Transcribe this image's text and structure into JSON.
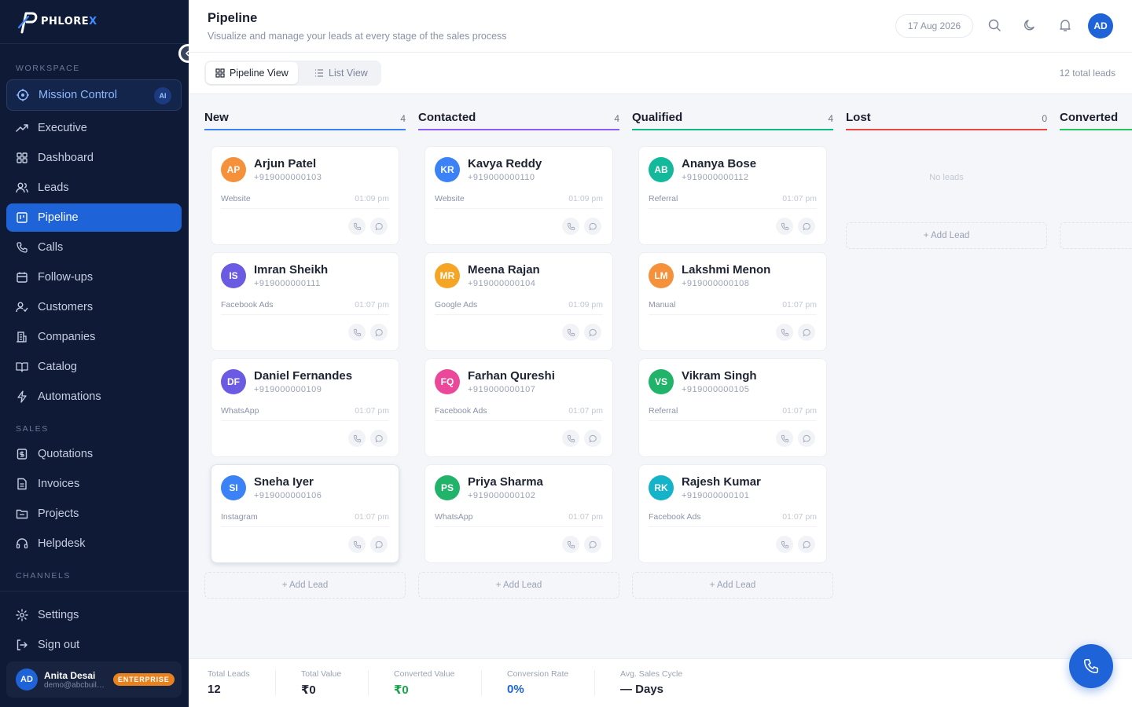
{
  "brand": {
    "name_main": "PHLORE",
    "name_accent": "X"
  },
  "sidebar": {
    "sections": {
      "workspace": "WORKSPACE",
      "sales": "SALES",
      "channels": "CHANNELS"
    },
    "mission_control": {
      "label": "Mission Control",
      "badge": "AI"
    },
    "workspace_items": [
      {
        "label": "Executive",
        "icon": "trending-up-icon"
      },
      {
        "label": "Dashboard",
        "icon": "grid-icon"
      },
      {
        "label": "Leads",
        "icon": "users-icon"
      },
      {
        "label": "Pipeline",
        "icon": "kanban-icon",
        "active": true
      },
      {
        "label": "Calls",
        "icon": "phone-icon"
      },
      {
        "label": "Follow-ups",
        "icon": "calendar-icon"
      },
      {
        "label": "Customers",
        "icon": "user-check-icon"
      },
      {
        "label": "Companies",
        "icon": "building-icon"
      },
      {
        "label": "Catalog",
        "icon": "book-icon"
      },
      {
        "label": "Automations",
        "icon": "bolt-icon"
      }
    ],
    "sales_items": [
      {
        "label": "Quotations",
        "icon": "receipt-icon"
      },
      {
        "label": "Invoices",
        "icon": "file-icon"
      },
      {
        "label": "Projects",
        "icon": "folder-icon"
      },
      {
        "label": "Helpdesk",
        "icon": "headset-icon"
      }
    ],
    "bottom_items": [
      {
        "label": "Settings",
        "icon": "gear-icon"
      },
      {
        "label": "Sign out",
        "icon": "logout-icon"
      }
    ],
    "user": {
      "initials": "AD",
      "name": "Anita Desai",
      "email": "demo@abcbuilders.com",
      "plan": "ENTERPRISE"
    }
  },
  "header": {
    "title": "Pipeline",
    "subtitle": "Visualize and manage your leads at every stage of the sales process",
    "date": "17 Aug 2026",
    "avatar": "AD"
  },
  "toolbar": {
    "pipeline_view": "Pipeline View",
    "list_view": "List View",
    "total_leads": "12 total leads"
  },
  "colors": {
    "accent": "#1e63d8",
    "new": "#3b82f6",
    "contacted": "#8b5cf6",
    "qualified": "#10b981",
    "lost": "#ef4444",
    "converted": "#22c55e"
  },
  "columns": [
    {
      "title": "New",
      "count": "4",
      "color": "#3b82f6",
      "add_label": "+ Add Lead",
      "leads": [
        {
          "initials": "AP",
          "name": "Arjun Patel",
          "phone": "+919000000103",
          "source": "Website",
          "time": "01:09 pm",
          "color": "#f4913a"
        },
        {
          "initials": "IS",
          "name": "Imran Sheikh",
          "phone": "+919000000111",
          "source": "Facebook Ads",
          "time": "01:07 pm",
          "color": "#6a5be2"
        },
        {
          "initials": "DF",
          "name": "Daniel Fernandes",
          "phone": "+919000000109",
          "source": "WhatsApp",
          "time": "01:07 pm",
          "color": "#6a5be2"
        },
        {
          "initials": "SI",
          "name": "Sneha Iyer",
          "phone": "+919000000106",
          "source": "Instagram",
          "time": "01:07 pm",
          "color": "#3b82f6"
        }
      ]
    },
    {
      "title": "Contacted",
      "count": "4",
      "color": "#8b5cf6",
      "add_label": "+ Add Lead",
      "leads": [
        {
          "initials": "KR",
          "name": "Kavya Reddy",
          "phone": "+919000000110",
          "source": "Website",
          "time": "01:09 pm",
          "color": "#3b82f6"
        },
        {
          "initials": "MR",
          "name": "Meena Rajan",
          "phone": "+919000000104",
          "source": "Google Ads",
          "time": "01:09 pm",
          "color": "#f5a524"
        },
        {
          "initials": "FQ",
          "name": "Farhan Qureshi",
          "phone": "+919000000107",
          "source": "Facebook Ads",
          "time": "01:07 pm",
          "color": "#ec4899"
        },
        {
          "initials": "PS",
          "name": "Priya Sharma",
          "phone": "+919000000102",
          "source": "WhatsApp",
          "time": "01:07 pm",
          "color": "#22b36a"
        }
      ]
    },
    {
      "title": "Qualified",
      "count": "4",
      "color": "#10b981",
      "add_label": "+ Add Lead",
      "leads": [
        {
          "initials": "AB",
          "name": "Ananya Bose",
          "phone": "+919000000112",
          "source": "Referral",
          "time": "01:07 pm",
          "color": "#14b89a"
        },
        {
          "initials": "LM",
          "name": "Lakshmi Menon",
          "phone": "+919000000108",
          "source": "Manual",
          "time": "01:07 pm",
          "color": "#f4913a"
        },
        {
          "initials": "VS",
          "name": "Vikram Singh",
          "phone": "+919000000105",
          "source": "Referral",
          "time": "01:07 pm",
          "color": "#22b36a"
        },
        {
          "initials": "RK",
          "name": "Rajesh Kumar",
          "phone": "+919000000101",
          "source": "Facebook Ads",
          "time": "01:07 pm",
          "color": "#14b3c9"
        }
      ]
    },
    {
      "title": "Lost",
      "count": "0",
      "color": "#ef4444",
      "add_label": "+ Add Lead",
      "empty_label": "No leads",
      "leads": []
    },
    {
      "title": "Converted",
      "count": "",
      "color": "#22c55e",
      "add_label": "",
      "leads": []
    }
  ],
  "footer": {
    "stats": [
      {
        "label": "Total Leads",
        "value": "12",
        "color": "#1f2433"
      },
      {
        "label": "Total Value",
        "value": "₹0",
        "color": "#1f2433"
      },
      {
        "label": "Converted Value",
        "value": "₹0",
        "color": "#16a34a"
      },
      {
        "label": "Conversion Rate",
        "value": "0%",
        "color": "#1e63d8"
      },
      {
        "label": "Avg. Sales Cycle",
        "value": "— Days",
        "color": "#1f2433"
      }
    ]
  }
}
